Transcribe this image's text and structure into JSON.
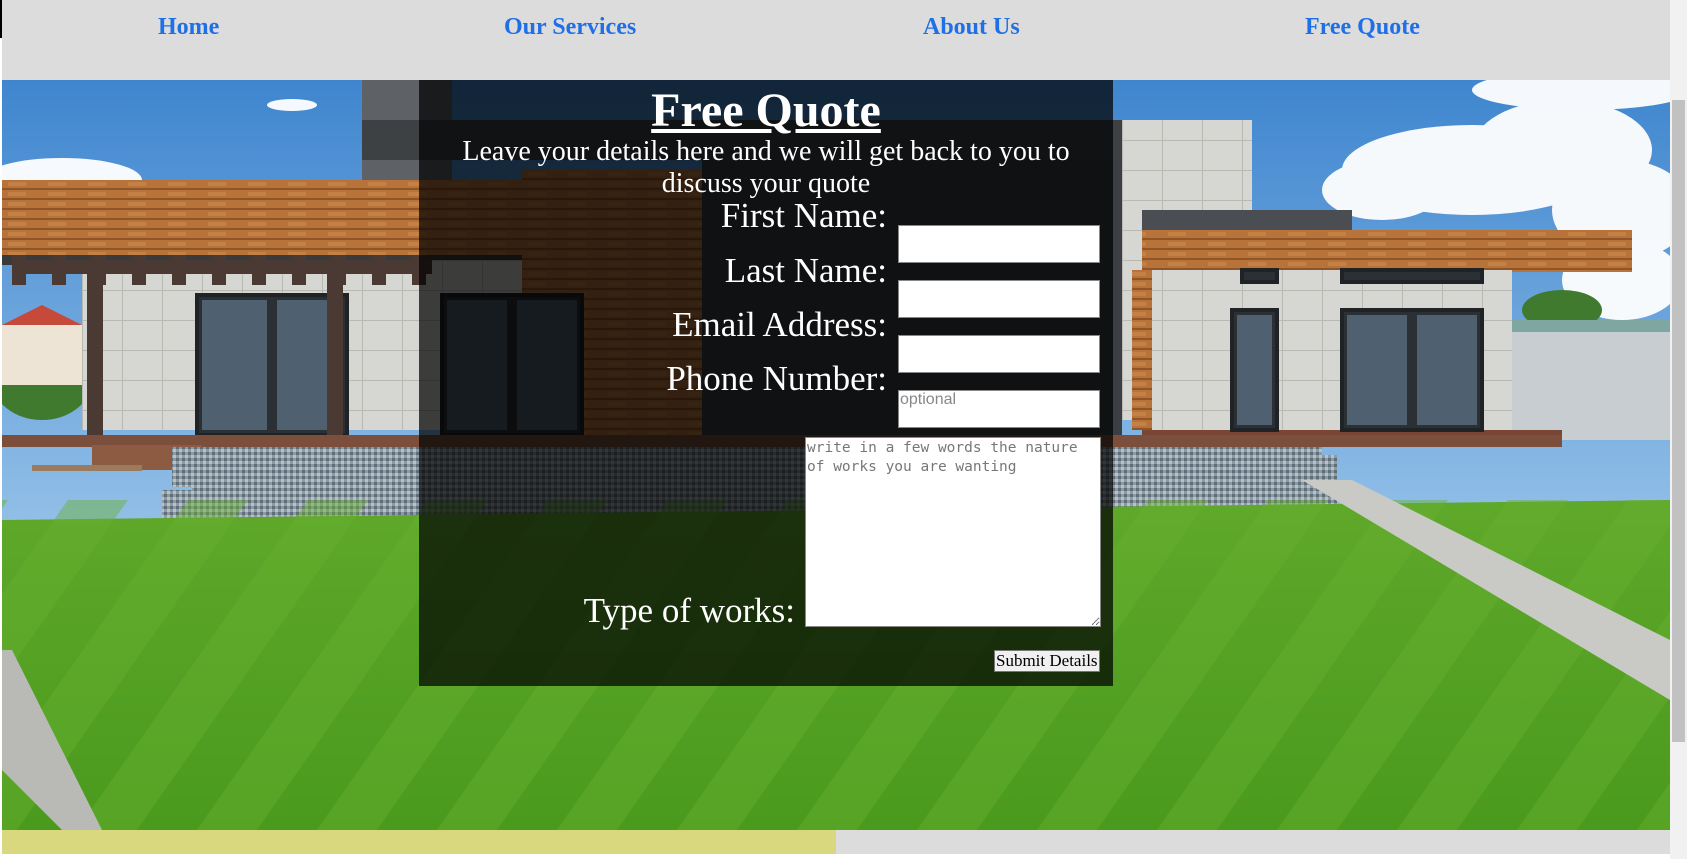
{
  "nav": {
    "items": [
      {
        "label": "Home"
      },
      {
        "label": "Our Services"
      },
      {
        "label": "About Us"
      },
      {
        "label": "Free Quote"
      }
    ]
  },
  "form": {
    "title": "Free Quote",
    "subtitle": "Leave your details here and we will get back to you to discuss your quote",
    "first_name_label": "First Name:",
    "last_name_label": "Last Name:",
    "email_label": "Email Address:",
    "phone_label": "Phone Number:",
    "phone_placeholder": "optional",
    "works_label": "Type of works:",
    "works_placeholder": "write in a few words the nature of works you are wanting",
    "submit_label": "Submit Details"
  },
  "progress": {
    "fraction": 0.5
  },
  "colors": {
    "nav_link": "#1f6fe6",
    "nav_bg": "#dcdcdc",
    "progress_fill": "#d9d87f"
  }
}
